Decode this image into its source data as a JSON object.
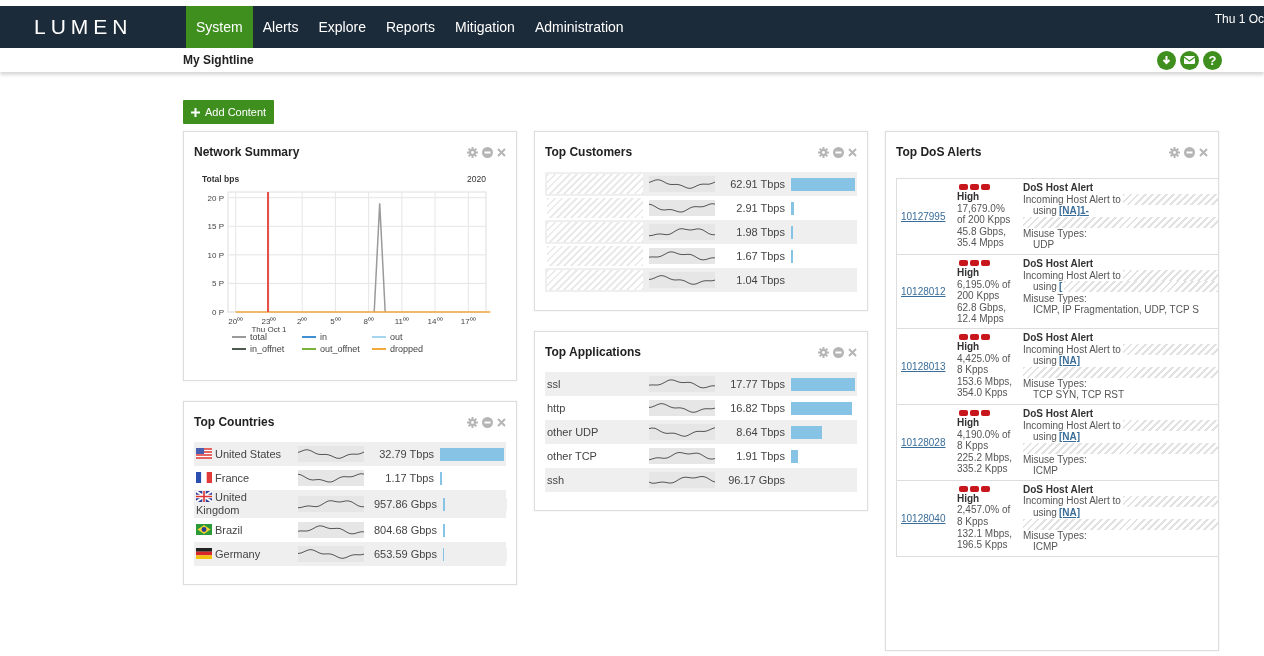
{
  "header": {
    "logo": "LUMEN",
    "nav": [
      {
        "label": "System",
        "selected": true
      },
      {
        "label": "Alerts",
        "selected": false
      },
      {
        "label": "Explore",
        "selected": false
      },
      {
        "label": "Reports",
        "selected": false
      },
      {
        "label": "Mitigation",
        "selected": false
      },
      {
        "label": "Administration",
        "selected": false
      }
    ],
    "datetime": "Thu 1 Oc"
  },
  "subheader": {
    "title": "My Sightline",
    "buttons": [
      {
        "kind": "download"
      },
      {
        "kind": "mail"
      },
      {
        "kind": "help",
        "glyph": "?"
      }
    ]
  },
  "add_content_button": {
    "label": "Add Content"
  },
  "columns": [
    [
      {
        "kind": "chart",
        "title": "Network Summary",
        "year": "2020",
        "date_label": "Thu Oct 1",
        "chart_data": {
          "type": "line",
          "ylabel": "Total bps",
          "ylim": [
            0,
            21
          ],
          "categories": [
            "20⁰⁰",
            null,
            null,
            null,
            null,
            null,
            "23⁰⁰",
            null,
            null,
            null,
            null,
            null,
            "2⁰⁰",
            null,
            null,
            null,
            null,
            null,
            "5⁰⁰",
            null,
            null,
            null,
            null,
            null,
            "8⁰⁰",
            null,
            null,
            null,
            null,
            null,
            "11⁰⁰",
            null,
            null,
            null,
            null,
            null,
            "14⁰⁰",
            null,
            null,
            null,
            null,
            null,
            "17⁰⁰",
            null,
            null,
            null,
            null
          ],
          "yticks": [
            {
              "value": 0,
              "label": "0 P"
            },
            {
              "value": 5,
              "label": "5 P"
            },
            {
              "value": 10,
              "label": "10 P"
            },
            {
              "value": 15,
              "label": "15 P"
            },
            {
              "value": 20,
              "label": "20 P"
            }
          ],
          "series": [
            {
              "name": "total",
              "color": "#9a9a9a",
              "values": [
                null,
                null,
                null,
                null,
                null,
                null,
                null,
                null,
                null,
                null,
                null,
                null,
                null,
                null,
                null,
                null,
                null,
                null,
                null,
                null,
                null,
                null,
                null,
                null,
                null,
                0,
                19,
                0,
                null,
                null,
                null,
                null,
                null,
                null,
                null,
                null,
                null,
                null,
                null,
                null,
                null,
                null,
                null,
                null,
                null,
                null,
                null
              ]
            },
            {
              "name": "in",
              "color": "#3f8fd2",
              "values": [
                null,
                null,
                null,
                null,
                null,
                null,
                null,
                null,
                null,
                null,
                null,
                null,
                null,
                null,
                null,
                null,
                null,
                null,
                null,
                null,
                null,
                null,
                null,
                null,
                null,
                null,
                null,
                null,
                null,
                null,
                null,
                null,
                null,
                null,
                null,
                null,
                null,
                null,
                null,
                null,
                null,
                null,
                null,
                null,
                null,
                null,
                null
              ]
            },
            {
              "name": "out",
              "color": "#a6d5f0",
              "values": [
                null,
                null,
                null,
                null,
                null,
                null,
                null,
                null,
                null,
                null,
                null,
                null,
                null,
                null,
                null,
                null,
                null,
                null,
                null,
                null,
                null,
                null,
                null,
                null,
                null,
                null,
                null,
                null,
                null,
                null,
                null,
                null,
                null,
                null,
                null,
                null,
                null,
                null,
                null,
                null,
                null,
                null,
                null,
                null,
                null,
                null,
                null
              ]
            },
            {
              "name": "in_offnet",
              "color": "#4d5a4d",
              "values": [
                null,
                null,
                null,
                null,
                null,
                null,
                null,
                null,
                null,
                null,
                null,
                null,
                null,
                null,
                null,
                null,
                null,
                null,
                null,
                null,
                null,
                null,
                null,
                null,
                null,
                null,
                null,
                null,
                null,
                null,
                null,
                null,
                null,
                null,
                null,
                null,
                null,
                null,
                null,
                null,
                null,
                null,
                null,
                null,
                null,
                null,
                null
              ]
            },
            {
              "name": "out_offnet",
              "color": "#79b33a",
              "values": [
                null,
                null,
                null,
                null,
                null,
                null,
                null,
                null,
                null,
                null,
                null,
                null,
                null,
                null,
                null,
                null,
                null,
                null,
                null,
                null,
                null,
                null,
                null,
                null,
                null,
                null,
                null,
                null,
                null,
                null,
                null,
                null,
                null,
                null,
                null,
                null,
                null,
                null,
                null,
                null,
                null,
                null,
                null,
                null,
                null,
                null,
                null
              ]
            },
            {
              "name": "dropped",
              "color": "#f2a93b",
              "values": [
                0,
                0,
                0,
                0,
                0,
                0,
                0,
                0,
                0,
                0,
                0,
                0,
                0,
                0,
                0,
                0,
                0,
                0,
                0,
                0,
                0,
                0,
                0,
                0,
                0,
                0,
                0,
                0,
                0,
                0,
                0,
                0,
                0,
                0,
                0,
                0,
                0,
                0,
                0,
                0,
                0,
                0,
                0,
                0,
                0,
                0,
                0
              ]
            }
          ],
          "grid": true
        },
        "marker_line": {
          "color": "#e8504a"
        }
      },
      {
        "kind": "ranking",
        "title": "Top Countries",
        "rows": [
          {
            "kind": "us",
            "name": "United States",
            "value": "32.79 Tbps",
            "level": 1
          },
          {
            "kind": "fr",
            "name": "France",
            "value": "1.17 Tbps",
            "level": 0.036
          },
          {
            "kind": "gb",
            "name": "United Kingdom",
            "value": "957.86 Gbps",
            "level": 0.029
          },
          {
            "kind": "br",
            "name": "Brazil",
            "value": "804.68 Gbps",
            "level": 0.025
          },
          {
            "kind": "de",
            "name": "Germany",
            "value": "653.59 Gbps",
            "level": 0.02
          }
        ]
      }
    ],
    [
      {
        "kind": "ranking",
        "title": "Top Customers",
        "rows": [
          {
            "value": "62.91 Tbps",
            "level": 1
          },
          {
            "value": "2.91 Tbps",
            "level": 0.046
          },
          {
            "value": "1.98 Tbps",
            "level": 0.031
          },
          {
            "value": "1.67 Tbps",
            "level": 0.027
          },
          {
            "value": "1.04 Tbps"
          }
        ]
      },
      {
        "kind": "ranking",
        "title": "Top Applications",
        "rows": [
          {
            "name": "ssl",
            "value": "17.77 Tbps",
            "level": 1
          },
          {
            "name": "http",
            "value": "16.82 Tbps",
            "level": 0.946
          },
          {
            "name": "other UDP",
            "value": "8.64 Tbps",
            "level": 0.486
          },
          {
            "name": "other TCP",
            "value": "1.91 Tbps",
            "level": 0.107
          },
          {
            "name": "ssh",
            "value": "96.17 Gbps"
          }
        ]
      }
    ],
    [
      {
        "kind": "alerts",
        "title": "Top DoS Alerts",
        "alerts": [
          {
            "id": "10127995",
            "stars": 3,
            "severity": "High",
            "stats": [
              "17,679.0%",
              "of 200 Kpps",
              "45.8 Gbps,",
              "35.4 Mpps"
            ],
            "type": "DoS Host Alert",
            "target": "Incoming Host Alert to",
            "using": "using",
            "link": "[NA]1-",
            "redacted_line": true,
            "misuse_label": "Misuse Types:",
            "misuse": "UDP"
          },
          {
            "id": "10128012",
            "stars": 3,
            "severity": "High",
            "stats": [
              "6,195.0% of",
              "200 Kpps",
              "62.8 Gbps,",
              "12.4 Mpps"
            ],
            "type": "DoS Host Alert",
            "target": "Incoming Host Alert to",
            "using": "using",
            "link": "[",
            "redacted_line": false,
            "misuse_label": "Misuse Types:",
            "misuse": "ICMP, IP Fragmentation, UDP, TCP S"
          },
          {
            "id": "10128013",
            "stars": 3,
            "severity": "High",
            "stats": [
              "4,425.0% of",
              "8 Kpps",
              "153.6 Mbps,",
              "354.0 Kpps"
            ],
            "type": "DoS Host Alert",
            "target": "Incoming Host Alert to",
            "using": "using",
            "link": "[NA]",
            "redacted_line": true,
            "misuse_label": "Misuse Types:",
            "misuse": "TCP SYN, TCP RST"
          },
          {
            "id": "10128028",
            "stars": 3,
            "severity": "High",
            "stats": [
              "4,190.0% of",
              "8 Kpps",
              "225.2 Mbps,",
              "335.2 Kpps"
            ],
            "type": "DoS Host Alert",
            "target": "Incoming Host Alert to",
            "using": "using",
            "link": "[NA]",
            "redacted_line": true,
            "misuse_label": "Misuse Types:",
            "misuse": "ICMP"
          },
          {
            "id": "10128040",
            "stars": 3,
            "severity": "High",
            "stats": [
              "2,457.0% of",
              "8 Kpps",
              "132.1 Mbps,",
              "196.5 Kpps"
            ],
            "type": "DoS Host Alert",
            "target": "Incoming Host Alert to",
            "using": "using",
            "link": "[NA]",
            "redacted_line": true,
            "misuse_label": "Misuse Types:",
            "misuse": "ICMP"
          }
        ]
      }
    ]
  ]
}
